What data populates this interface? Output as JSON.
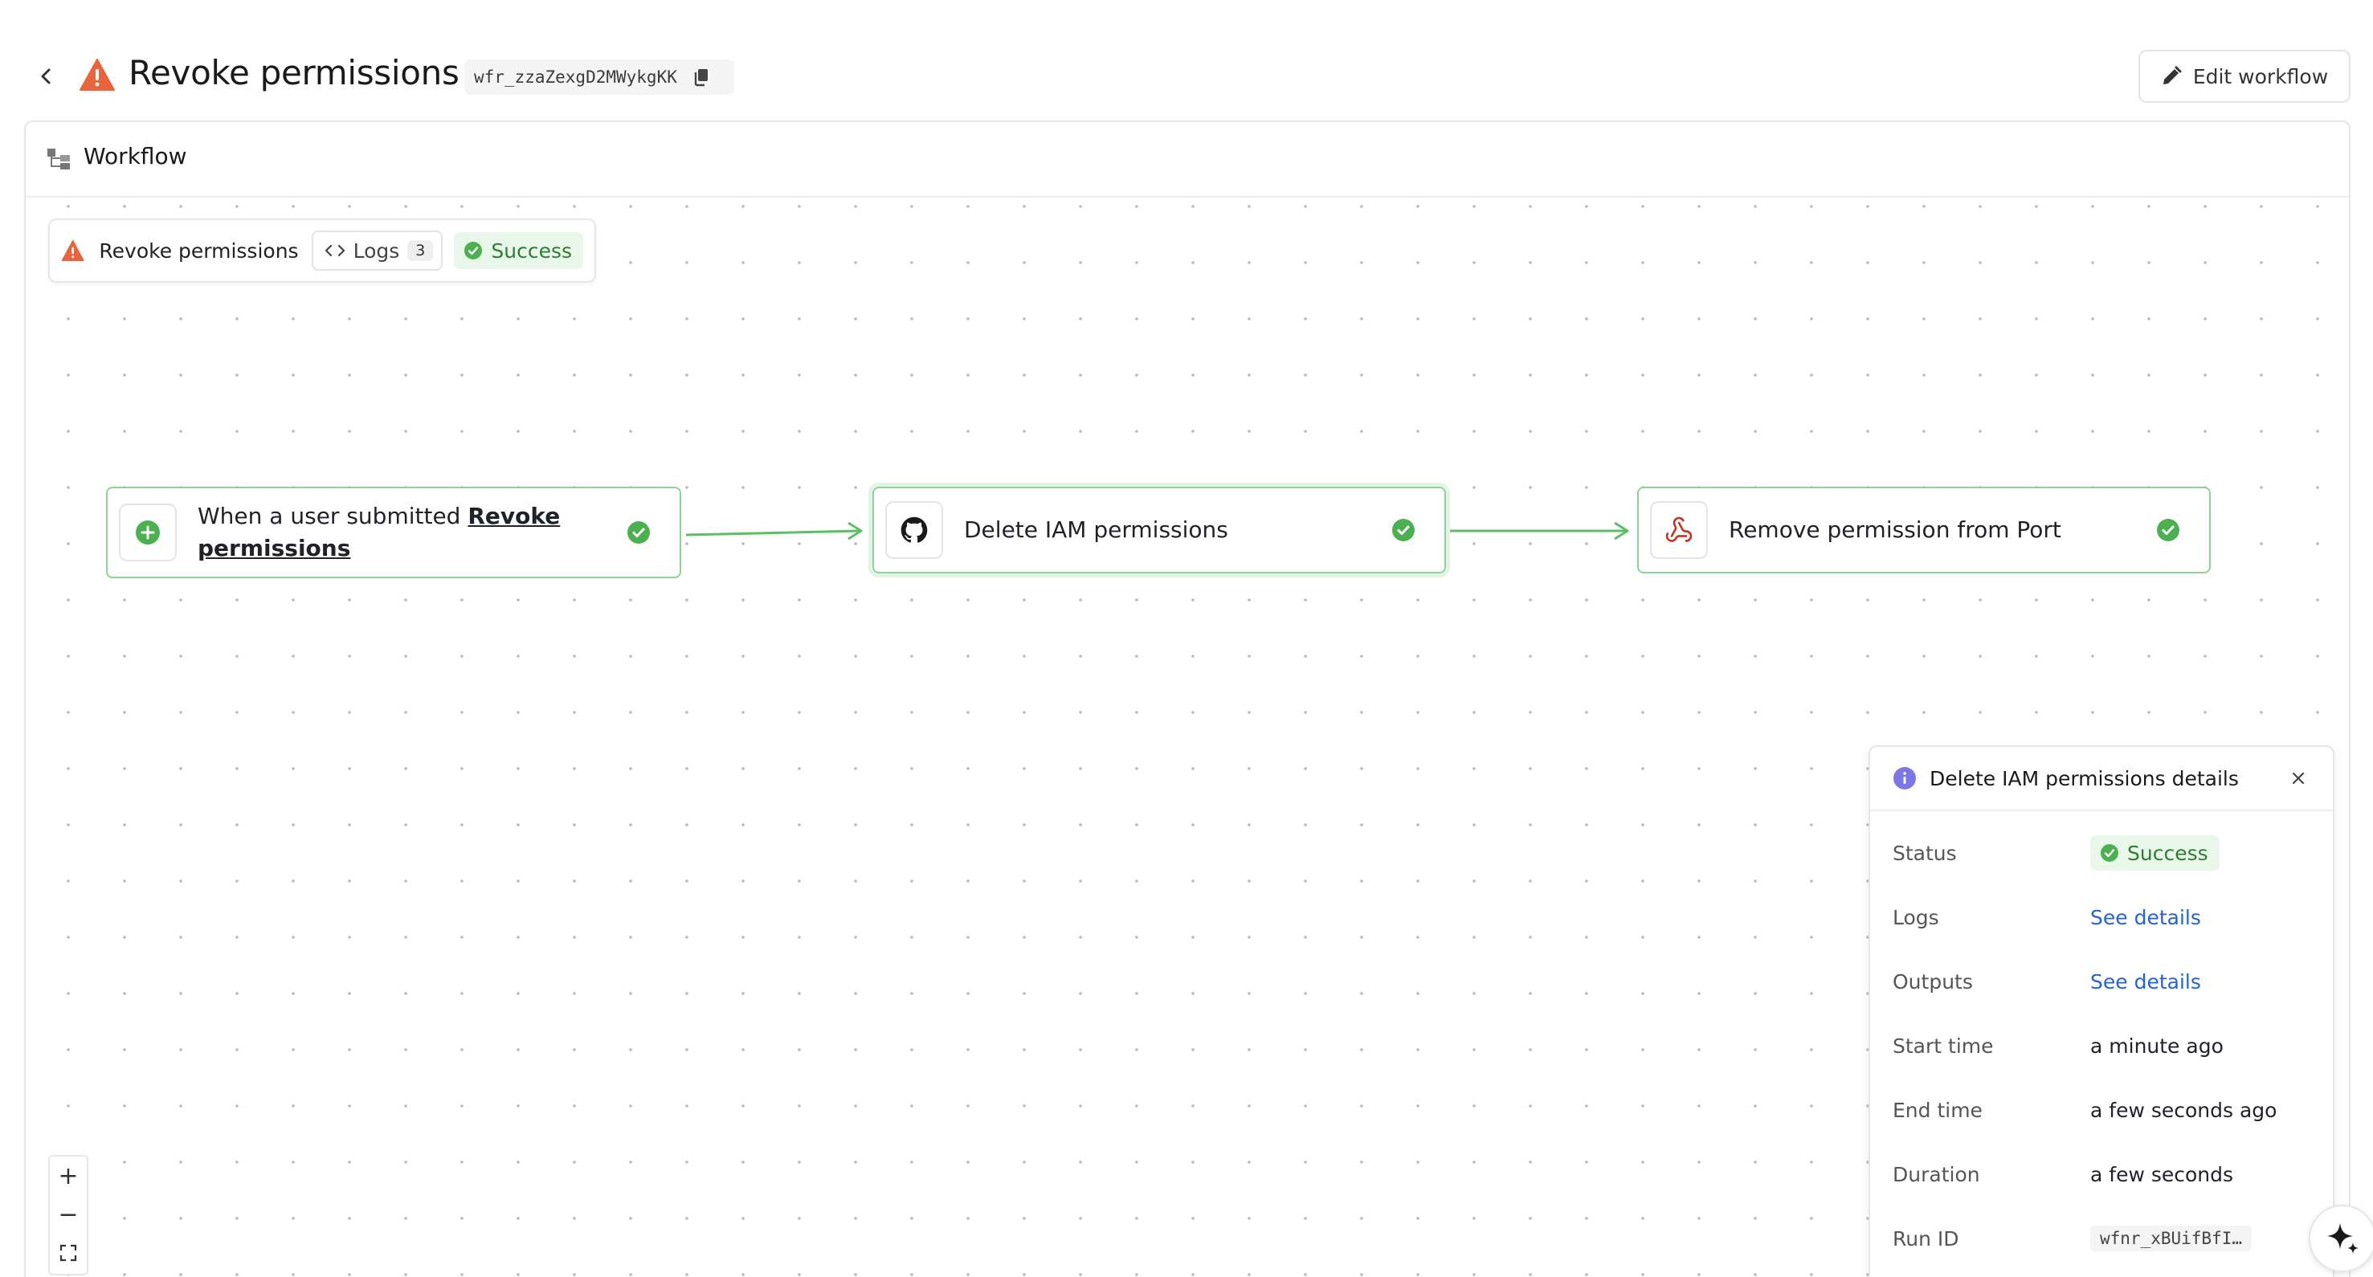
{
  "header": {
    "title": "Revoke permissions",
    "run_id": "wfr_zzaZexgD2MWykgKK",
    "edit_label": "Edit workflow"
  },
  "panel": {
    "title": "Workflow"
  },
  "run_bar": {
    "name": "Revoke permissions",
    "logs_label": "Logs",
    "logs_count": "3",
    "status": "Success"
  },
  "nodes": [
    {
      "prefix": "When a user submitted ",
      "link": "Revoke permissions",
      "status": "success"
    },
    {
      "label": "Delete IAM permissions",
      "status": "success"
    },
    {
      "label": "Remove permission from Port",
      "status": "success"
    }
  ],
  "details": {
    "title": "Delete IAM permissions details",
    "rows": {
      "status_key": "Status",
      "status_val": "Success",
      "logs_key": "Logs",
      "logs_val": "See details",
      "outputs_key": "Outputs",
      "outputs_val": "See details",
      "start_key": "Start time",
      "start_val": "a minute ago",
      "end_key": "End time",
      "end_val": "a few seconds ago",
      "duration_key": "Duration",
      "duration_val": "a few seconds",
      "runid_key": "Run ID",
      "runid_val": "wfnr_xBUifBfI…"
    }
  },
  "zoom": {
    "in": "+",
    "out": "−"
  },
  "colors": {
    "success": "#4caf50",
    "warning": "#e8643c",
    "link": "#2463d6",
    "info": "#7b78e6"
  }
}
